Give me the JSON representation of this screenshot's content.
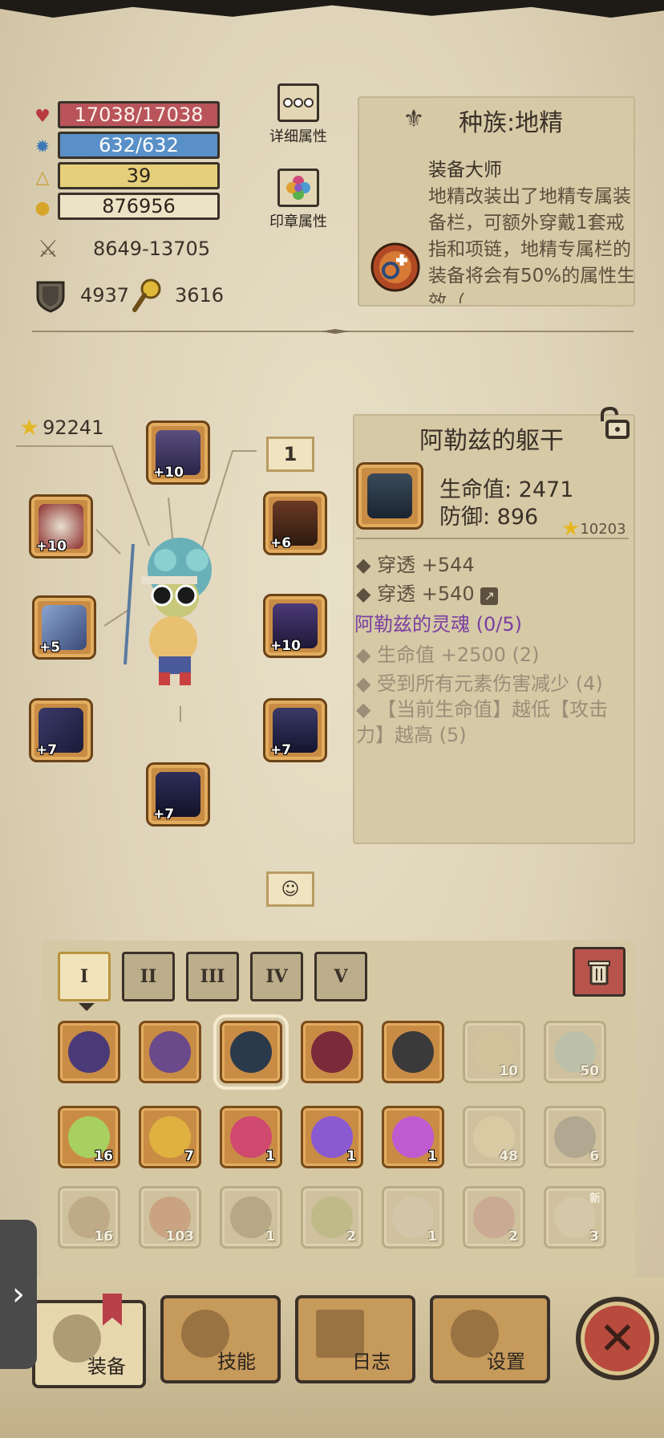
{
  "stats": {
    "hp": "17038/17038",
    "mp": "632/632",
    "level": "39",
    "gold": "876956",
    "attack_range": "8649-13705",
    "defense": "4937",
    "luck": "3616"
  },
  "buttons": {
    "detail_attrs": "详细属性",
    "seal_attrs": "印章属性"
  },
  "race": {
    "title": "种族:地精",
    "skill_name": "装备大师",
    "skill_desc": "地精改装出了地精专属装备栏，可额外穿戴1套戒指和项链，地精专属栏的装备将会有50%的属性生效（"
  },
  "equipment": {
    "gear_score": "92241",
    "tag_label": "1",
    "slots": [
      {
        "name": "helmet",
        "plus": "+10"
      },
      {
        "name": "amulet",
        "plus": "+10"
      },
      {
        "name": "armor-shoulder",
        "plus": "+6"
      },
      {
        "name": "weapon",
        "plus": "+5"
      },
      {
        "name": "gloves-right",
        "plus": "+10"
      },
      {
        "name": "boots-left",
        "plus": "+7"
      },
      {
        "name": "belt",
        "plus": "+7"
      },
      {
        "name": "legs",
        "plus": "+7"
      }
    ]
  },
  "item_detail": {
    "title": "阿勒兹的躯干",
    "hp": "生命值: 2471",
    "defense": "防御: 896",
    "score": "10203",
    "lines": [
      "穿透 +544",
      "穿透 +540"
    ],
    "set_name": "阿勒兹的灵魂 (0/5)",
    "set_bonuses": [
      "生命值 +2500 (2)",
      "受到所有元素伤害减少 (4)",
      "【当前生命值】越低【攻击力】越高 (5)"
    ]
  },
  "inventory": {
    "tiers": [
      "I",
      "II",
      "III",
      "IV",
      "V"
    ],
    "active_tier": "I",
    "row1": [
      {
        "icon": "helmet-icon",
        "count": "",
        "empty": false
      },
      {
        "icon": "ram-helmet-icon",
        "count": "",
        "empty": false
      },
      {
        "icon": "torso-armor-icon",
        "count": "",
        "empty": false,
        "selected": true
      },
      {
        "icon": "demon-armor-icon",
        "count": "",
        "empty": false
      },
      {
        "icon": "gauntlet-icon",
        "count": "",
        "empty": false
      },
      {
        "icon": "scroll-icon",
        "count": "10",
        "empty": true
      },
      {
        "icon": "eye-scroll-icon",
        "count": "50",
        "empty": true
      }
    ],
    "row2": [
      {
        "icon": "green-potion-icon",
        "count": "16",
        "empty": false
      },
      {
        "icon": "yellow-potion-icon",
        "count": "7",
        "empty": false
      },
      {
        "icon": "star-potion-icon",
        "count": "1",
        "empty": false
      },
      {
        "icon": "spiral-potion-icon",
        "count": "1",
        "empty": false
      },
      {
        "icon": "trident-potion-icon",
        "count": "1",
        "empty": false
      },
      {
        "icon": "map-icon",
        "count": "48",
        "empty": true
      },
      {
        "icon": "stone-icon",
        "count": "6",
        "empty": true
      }
    ],
    "row3": [
      {
        "icon": "chest-icon",
        "count": "16",
        "empty": true
      },
      {
        "icon": "meat-icon",
        "count": "103",
        "empty": true
      },
      {
        "icon": "mushroom-icon",
        "count": "1",
        "empty": true
      },
      {
        "icon": "herb-icon",
        "count": "2",
        "empty": true
      },
      {
        "icon": "seeds-icon",
        "count": "1",
        "empty": true
      },
      {
        "icon": "doll-icon",
        "count": "2",
        "empty": true
      },
      {
        "icon": "bone-icon",
        "count": "3",
        "empty": true,
        "new": "新"
      }
    ]
  },
  "nav": {
    "equip": "装备",
    "skills": "技能",
    "log": "日志",
    "settings": "设置"
  },
  "colors": {
    "hp": "#b8545a",
    "mp": "#5a90c8",
    "level": "#e6cf7a",
    "set_purple": "#7a3fa0"
  }
}
